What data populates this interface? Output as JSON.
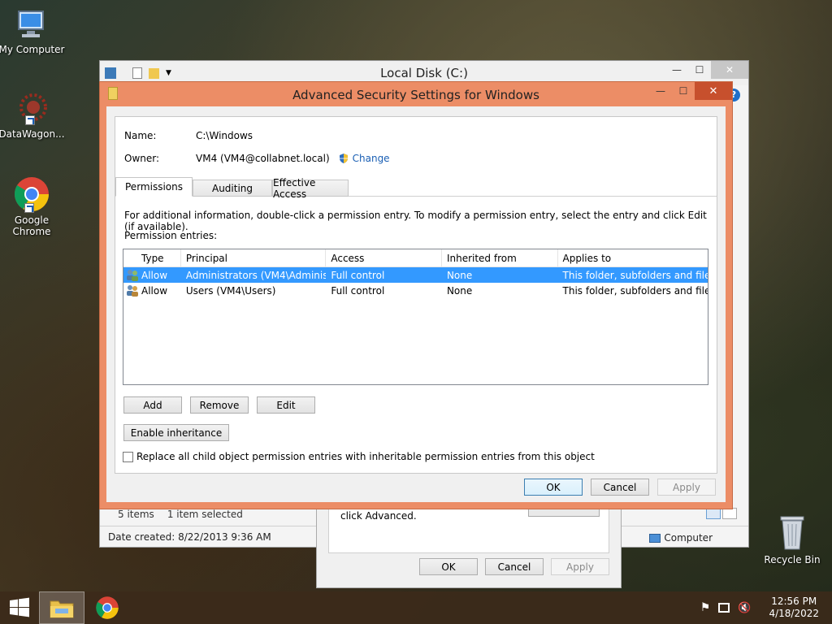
{
  "desktop": {
    "icons": [
      {
        "label": "My Computer"
      },
      {
        "label": "DataWagon..."
      },
      {
        "label": "Google Chrome"
      },
      {
        "label": "Recycle Bin"
      }
    ]
  },
  "explorer": {
    "title": "Local Disk (C:)",
    "status_items": "5 items",
    "status_selected": "1 item selected",
    "date_created": "Date created: 8/22/2013 9:36 AM",
    "computer_label": "Computer",
    "help": "?"
  },
  "properties_dialog": {
    "text": "click Advanced.",
    "ok": "OK",
    "cancel": "Cancel",
    "apply": "Apply"
  },
  "advanced": {
    "title": "Advanced Security Settings for Windows",
    "name_label": "Name:",
    "name_value": "C:\\Windows",
    "owner_label": "Owner:",
    "owner_value": "VM4 (VM4@collabnet.local)",
    "change_link": "Change",
    "tabs": [
      "Permissions",
      "Auditing",
      "Effective Access"
    ],
    "info_text": "For additional information, double-click a permission entry. To modify a permission entry, select the entry and click Edit (if available).",
    "entries_label": "Permission entries:",
    "columns": [
      "Type",
      "Principal",
      "Access",
      "Inherited from",
      "Applies to"
    ],
    "entries": [
      {
        "type": "Allow",
        "principal": "Administrators (VM4\\Adminis...",
        "access": "Full control",
        "inherited": "None",
        "applies": "This folder, subfolders and files",
        "selected": true
      },
      {
        "type": "Allow",
        "principal": "Users (VM4\\Users)",
        "access": "Full control",
        "inherited": "None",
        "applies": "This folder, subfolders and files",
        "selected": false
      }
    ],
    "add": "Add",
    "remove": "Remove",
    "edit": "Edit",
    "enable_inheritance": "Enable inheritance",
    "replace_checkbox": "Replace all child object permission entries with inheritable permission entries from this object",
    "ok": "OK",
    "cancel": "Cancel",
    "apply": "Apply"
  },
  "taskbar": {
    "time": "12:56 PM",
    "date": "4/18/2022"
  },
  "colors": {
    "dialog_frame": "#ec8d66",
    "selection": "#3399ff",
    "link": "#1a5fb4"
  }
}
